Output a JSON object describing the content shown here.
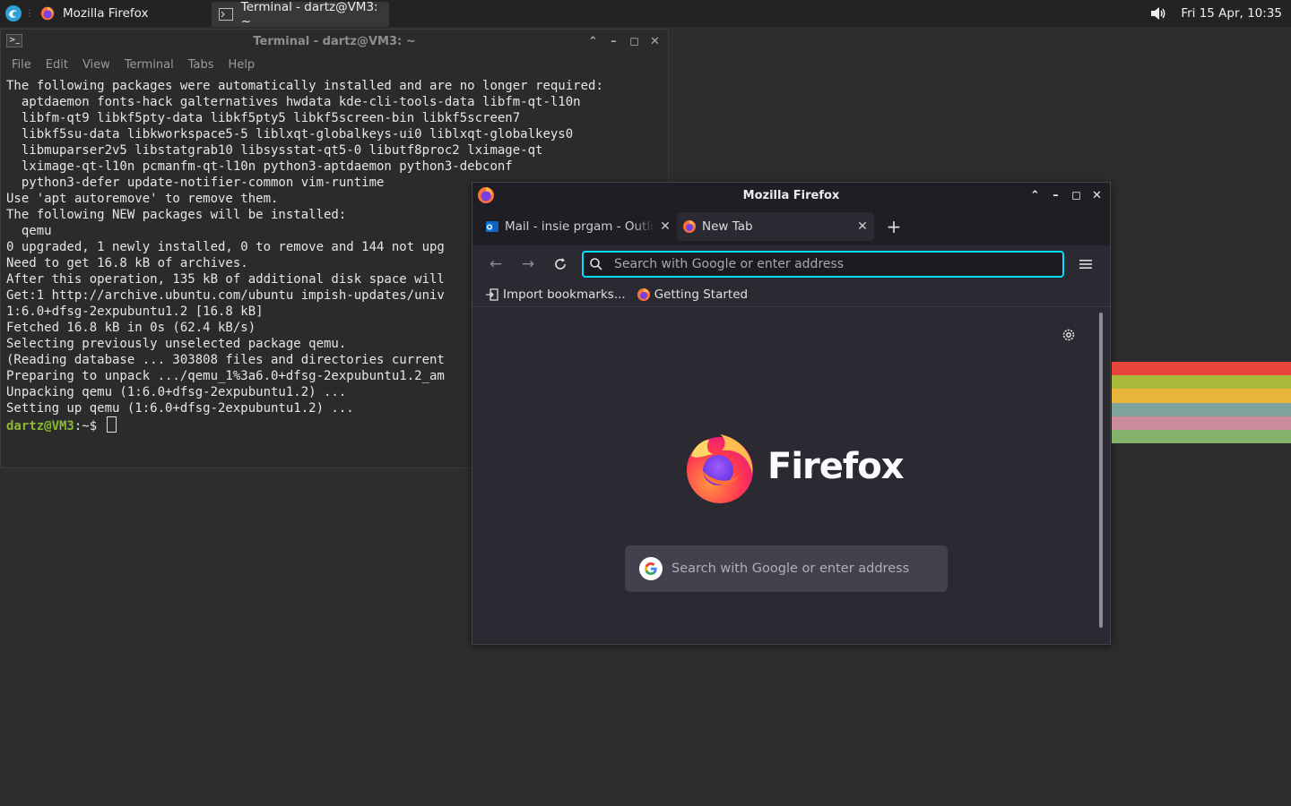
{
  "taskbar": {
    "tasks": [
      {
        "label": "Mozilla Firefox",
        "icon": "firefox-icon"
      },
      {
        "label": "Terminal - dartz@VM3: ~",
        "icon": "terminal-icon"
      }
    ],
    "clock": "Fri 15 Apr, 10:35",
    "volume_icon": "speaker-icon"
  },
  "terminal": {
    "title": "Terminal - dartz@VM3: ~",
    "menu": [
      "File",
      "Edit",
      "View",
      "Terminal",
      "Tabs",
      "Help"
    ],
    "lines": [
      "The following packages were automatically installed and are no longer required:",
      "  aptdaemon fonts-hack galternatives hwdata kde-cli-tools-data libfm-qt-l10n",
      "  libfm-qt9 libkf5pty-data libkf5pty5 libkf5screen-bin libkf5screen7",
      "  libkf5su-data libkworkspace5-5 liblxqt-globalkeys-ui0 liblxqt-globalkeys0",
      "  libmuparser2v5 libstatgrab10 libsysstat-qt5-0 libutf8proc2 lximage-qt",
      "  lximage-qt-l10n pcmanfm-qt-l10n python3-aptdaemon python3-debconf",
      "  python3-defer update-notifier-common vim-runtime",
      "Use 'apt autoremove' to remove them.",
      "The following NEW packages will be installed:",
      "  qemu",
      "0 upgraded, 1 newly installed, 0 to remove and 144 not upg",
      "Need to get 16.8 kB of archives.",
      "After this operation, 135 kB of additional disk space will",
      "Get:1 http://archive.ubuntu.com/ubuntu impish-updates/univ",
      "1:6.0+dfsg-2expubuntu1.2 [16.8 kB]",
      "Fetched 16.8 kB in 0s (62.4 kB/s)",
      "Selecting previously unselected package qemu.",
      "(Reading database ... 303808 files and directories current",
      "Preparing to unpack .../qemu_1%3a6.0+dfsg-2expubuntu1.2_am",
      "Unpacking qemu (1:6.0+dfsg-2expubuntu1.2) ...",
      "Setting up qemu (1:6.0+dfsg-2expubuntu1.2) ..."
    ],
    "prompt": "dartz@VM3",
    "prompt_suffix": ":~$"
  },
  "firefox": {
    "title": "Mozilla Firefox",
    "tabs": [
      {
        "label": "Mail - insie prgam - Outlook"
      },
      {
        "label": "New Tab"
      }
    ],
    "new_tab_symbol": "+",
    "url_placeholder": "Search with Google or enter address",
    "bookmarks": [
      "Import bookmarks...",
      "Getting Started"
    ],
    "brand": "Firefox",
    "search_placeholder": "Search with Google or enter address",
    "accent_color": "#00ddff"
  },
  "stripe_colors": [
    "#e8453c",
    "#a9b93a",
    "#e9b43a",
    "#7ea39a",
    "#cc8a9d",
    "#83b36a"
  ]
}
